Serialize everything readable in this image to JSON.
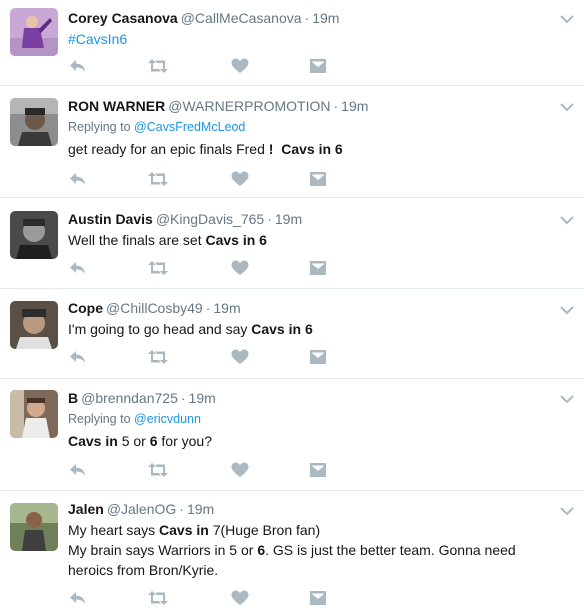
{
  "tweets": [
    {
      "name": "Corey Casanova",
      "handle": "@CallMeCasanova",
      "time": "19m",
      "reply_prefix": "",
      "reply_to": "",
      "lines": [
        [
          {
            "t": "#CavsIn6",
            "h": true
          }
        ]
      ]
    },
    {
      "name": "RON WARNER",
      "handle": "@WARNERPROMOTION",
      "time": "19m",
      "reply_prefix": "Replying to",
      "reply_to": "@CavsFredMcLeod",
      "lines": [
        [
          {
            "t": "get ready for an epic finals Fred "
          },
          {
            "t": "!",
            "b": true
          },
          {
            "t": "  "
          },
          {
            "t": "Cavs in 6",
            "b": true
          }
        ]
      ]
    },
    {
      "name": "Austin Davis",
      "handle": "@KingDavis_765",
      "time": "19m",
      "reply_prefix": "",
      "reply_to": "",
      "lines": [
        [
          {
            "t": "Well the finals are set "
          },
          {
            "t": "Cavs in 6",
            "b": true
          }
        ]
      ]
    },
    {
      "name": "Cope",
      "handle": "@ChillCosby49",
      "time": "19m",
      "reply_prefix": "",
      "reply_to": "",
      "lines": [
        [
          {
            "t": "I'm going to go head and say "
          },
          {
            "t": "Cavs in 6",
            "b": true
          }
        ]
      ]
    },
    {
      "name": "B",
      "handle": "@brenndan725",
      "time": "19m",
      "reply_prefix": "Replying to",
      "reply_to": "@ericvdunn",
      "lines": [
        [
          {
            "t": "Cavs in",
            "b": true
          },
          {
            "t": " 5 or "
          },
          {
            "t": "6",
            "b": true
          },
          {
            "t": " for you?"
          }
        ]
      ]
    },
    {
      "name": "Jalen",
      "handle": "@JalenOG",
      "time": "19m",
      "reply_prefix": "",
      "reply_to": "",
      "lines": [
        [
          {
            "t": "My heart says "
          },
          {
            "t": "Cavs in",
            "b": true
          },
          {
            "t": " 7(Huge Bron fan)"
          }
        ],
        [
          {
            "t": "My brain says Warriors in 5 or "
          },
          {
            "t": "6",
            "b": true
          },
          {
            "t": ". GS is just the better team. Gonna need"
          }
        ],
        [
          {
            "t": "heroics from Bron/Kyrie."
          }
        ]
      ]
    }
  ],
  "icons": {
    "reply": "reply-icon",
    "retweet": "retweet-icon",
    "like": "heart-icon",
    "dm": "direct-message-icon",
    "more": "chevron-down-icon"
  },
  "colors": {
    "name": "#14171a",
    "muted": "#657786",
    "link": "#1b95e0",
    "action_icon": "#aab8c2",
    "divider": "#e6ecf0"
  }
}
